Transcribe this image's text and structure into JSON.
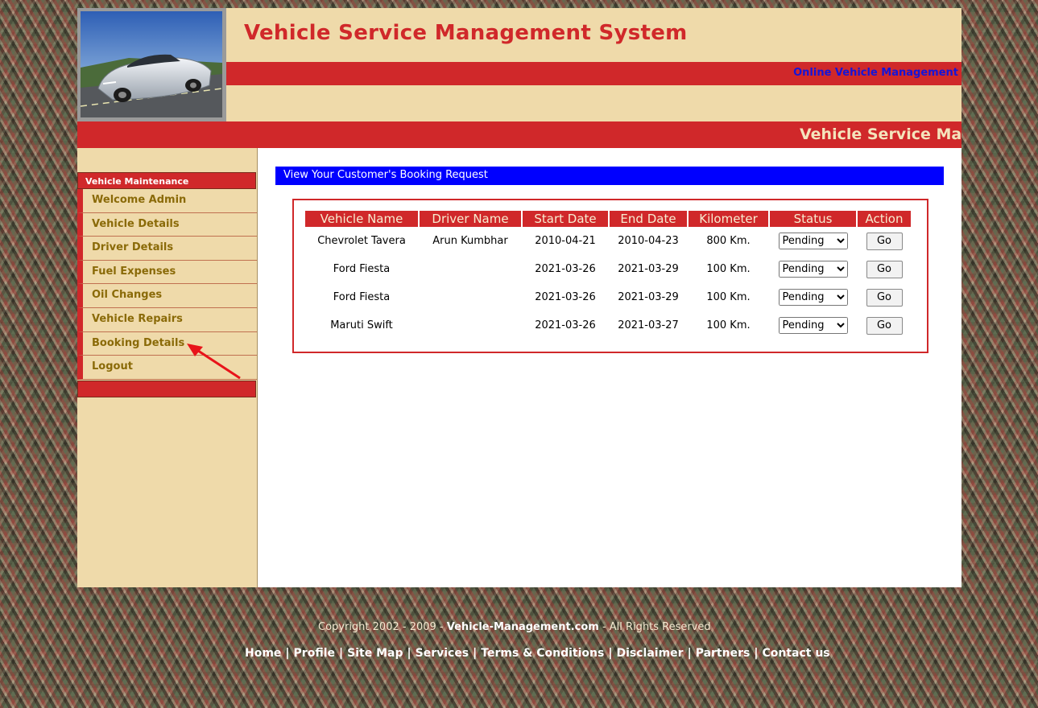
{
  "header": {
    "title": "Vehicle Service Management System",
    "marquee": "Online Vehicle Management",
    "banner": "Vehicle Service Man"
  },
  "sidebar": {
    "heading": "Vehicle Maintenance",
    "items": [
      {
        "label": "Welcome Admin"
      },
      {
        "label": "Vehicle Details"
      },
      {
        "label": "Driver Details"
      },
      {
        "label": "Fuel Expenses"
      },
      {
        "label": "Oil Changes"
      },
      {
        "label": "Vehicle Repairs"
      },
      {
        "label": "Booking Details"
      },
      {
        "label": "Logout"
      }
    ]
  },
  "main": {
    "section_title": "View Your Customer's Booking Request",
    "columns": [
      "Vehicle Name",
      "Driver Name",
      "Start Date",
      "End Date",
      "Kilometer",
      "Status",
      "Action"
    ],
    "rows": [
      {
        "vehicle": "Chevrolet Tavera",
        "driver": "Arun Kumbhar",
        "start": "2010-04-21",
        "end": "2010-04-23",
        "km": "800 Km.",
        "status": "Pending",
        "action": "Go"
      },
      {
        "vehicle": "Ford Fiesta",
        "driver": "",
        "start": "2021-03-26",
        "end": "2021-03-29",
        "km": "100 Km.",
        "status": "Pending",
        "action": "Go"
      },
      {
        "vehicle": "Ford Fiesta",
        "driver": "",
        "start": "2021-03-26",
        "end": "2021-03-29",
        "km": "100 Km.",
        "status": "Pending",
        "action": "Go"
      },
      {
        "vehicle": "Maruti Swift",
        "driver": "",
        "start": "2021-03-26",
        "end": "2021-03-27",
        "km": "100 Km.",
        "status": "Pending",
        "action": "Go"
      }
    ]
  },
  "footer": {
    "copyright_prefix": "Copyright 2002 - 2009 -",
    "copyright_site": "Vehicle-Management.com",
    "copyright_suffix": "- All Rights Reserved",
    "links": [
      "Home",
      "Profile",
      "Site Map",
      "Services",
      "Terms & Conditions",
      "Disclaimer",
      "Partners",
      "Contact us"
    ]
  },
  "colors": {
    "accent_red": "#d0282a",
    "sidebar_bg": "#efdaaa",
    "title_bar_blue": "#0000ff",
    "arrow": "#e8141a"
  },
  "annotation_icon": "red-arrow-icon"
}
